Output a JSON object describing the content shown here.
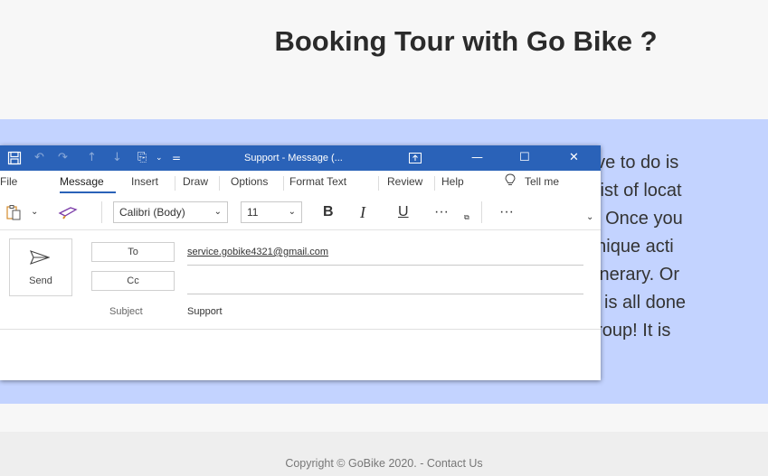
{
  "page": {
    "title": "Booking Tour with Go Bike ?",
    "body_lines": [
      "ave to do is",
      "t list of locat",
      "s. Once you",
      " unique acti",
      "itinerary. Or",
      "is is all done",
      " group! It is"
    ],
    "footer": "Copyright © GoBike 2020. - Contact Us"
  },
  "mail": {
    "window_title": "Support  -  Message (...",
    "menu": [
      "File",
      "Message",
      "Insert",
      "Draw",
      "Options",
      "Format Text",
      "Review",
      "Help"
    ],
    "active_menu": "Message",
    "tell_me": "Tell me",
    "font_name": "Calibri (Body)",
    "font_size": "11",
    "send_label": "Send",
    "to_label": "To",
    "cc_label": "Cc",
    "subject_label": "Subject",
    "to_value": "service.gobike4321@gmail.com",
    "subject_value": "Support"
  },
  "colors": {
    "titlebar": "#2a62b8",
    "content_band": "#c3d3ff"
  }
}
